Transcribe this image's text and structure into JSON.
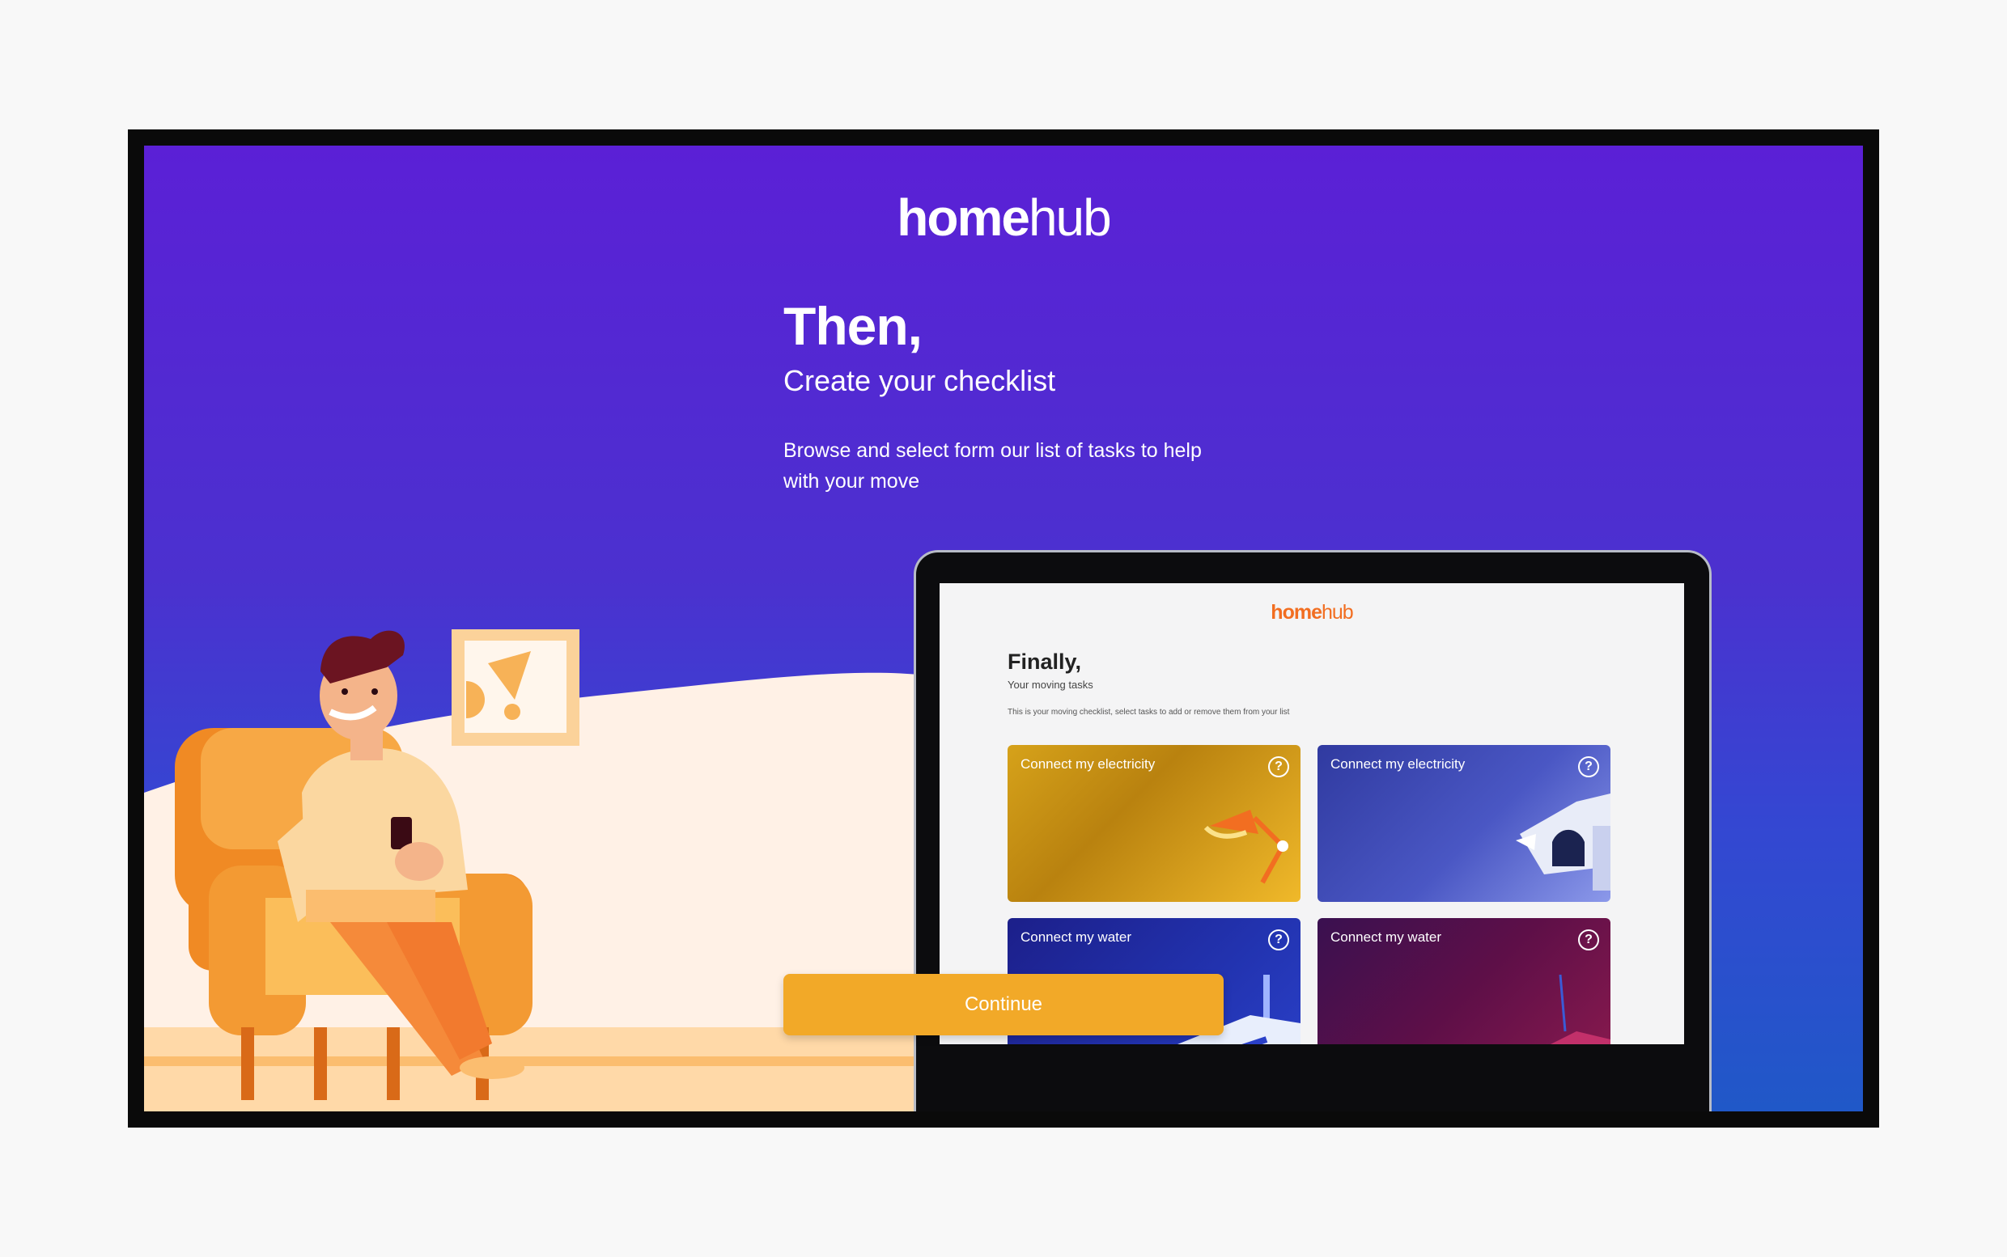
{
  "brand": {
    "logo_home": "home",
    "logo_hub": "hub"
  },
  "hero": {
    "headline": "Then,",
    "subhead": "Create your checklist",
    "description": "Browse and select form our list of tasks to help with your move"
  },
  "actions": {
    "continue_label": "Continue"
  },
  "preview": {
    "logo_home": "home",
    "logo_hub": "hub",
    "title": "Finally,",
    "subtitle": "Your moving tasks",
    "description": "This is your moving checklist, select tasks to add or remove them from your list",
    "cards": [
      {
        "label": "Connect my electricity",
        "help": "?",
        "icon": "desk-lamp-icon"
      },
      {
        "label": "Connect my electricity",
        "help": "?",
        "icon": "mailbox-icon"
      },
      {
        "label": "Connect my water",
        "help": "?",
        "icon": "water-pipe-icon"
      },
      {
        "label": "Connect my water",
        "help": "?",
        "icon": "tap-icon"
      }
    ]
  },
  "colors": {
    "gradient_top": "#5b20d6",
    "gradient_bottom": "#2058c8",
    "accent_orange": "#f2a928",
    "mini_logo": "#f26e21"
  }
}
